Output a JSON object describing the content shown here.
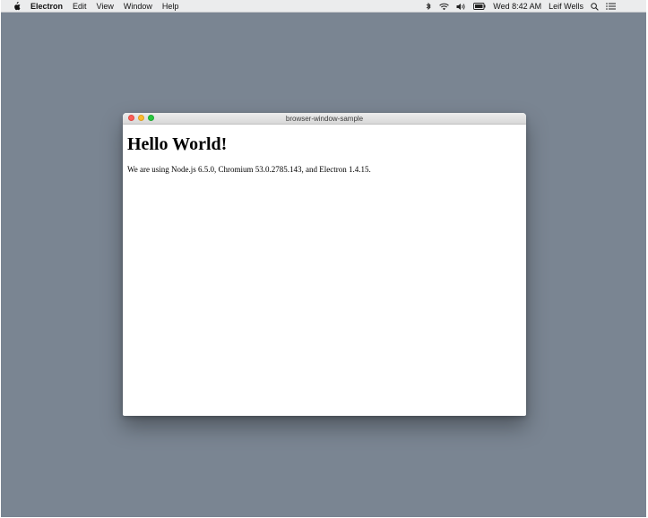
{
  "menubar": {
    "app_name": "Electron",
    "menus": [
      "Edit",
      "View",
      "Window",
      "Help"
    ],
    "status": {
      "clock": "Wed 8:42 AM",
      "user": "Leif Wells"
    },
    "icons": [
      "apple-icon",
      "bluetooth-icon",
      "wifi-icon",
      "volume-icon",
      "battery-icon",
      "search-icon",
      "notification-center-icon"
    ]
  },
  "window": {
    "title": "browser-window-sample",
    "heading": "Hello World!",
    "body_text": "We are using Node.js 6.5.0, Chromium 53.0.2785.143, and Electron 1.4.15."
  },
  "colors": {
    "desktop": "#7a8592",
    "menubar": "#ebeced",
    "close": "#fc5f57",
    "minimize": "#fdbc2e",
    "zoom": "#29c83f"
  }
}
